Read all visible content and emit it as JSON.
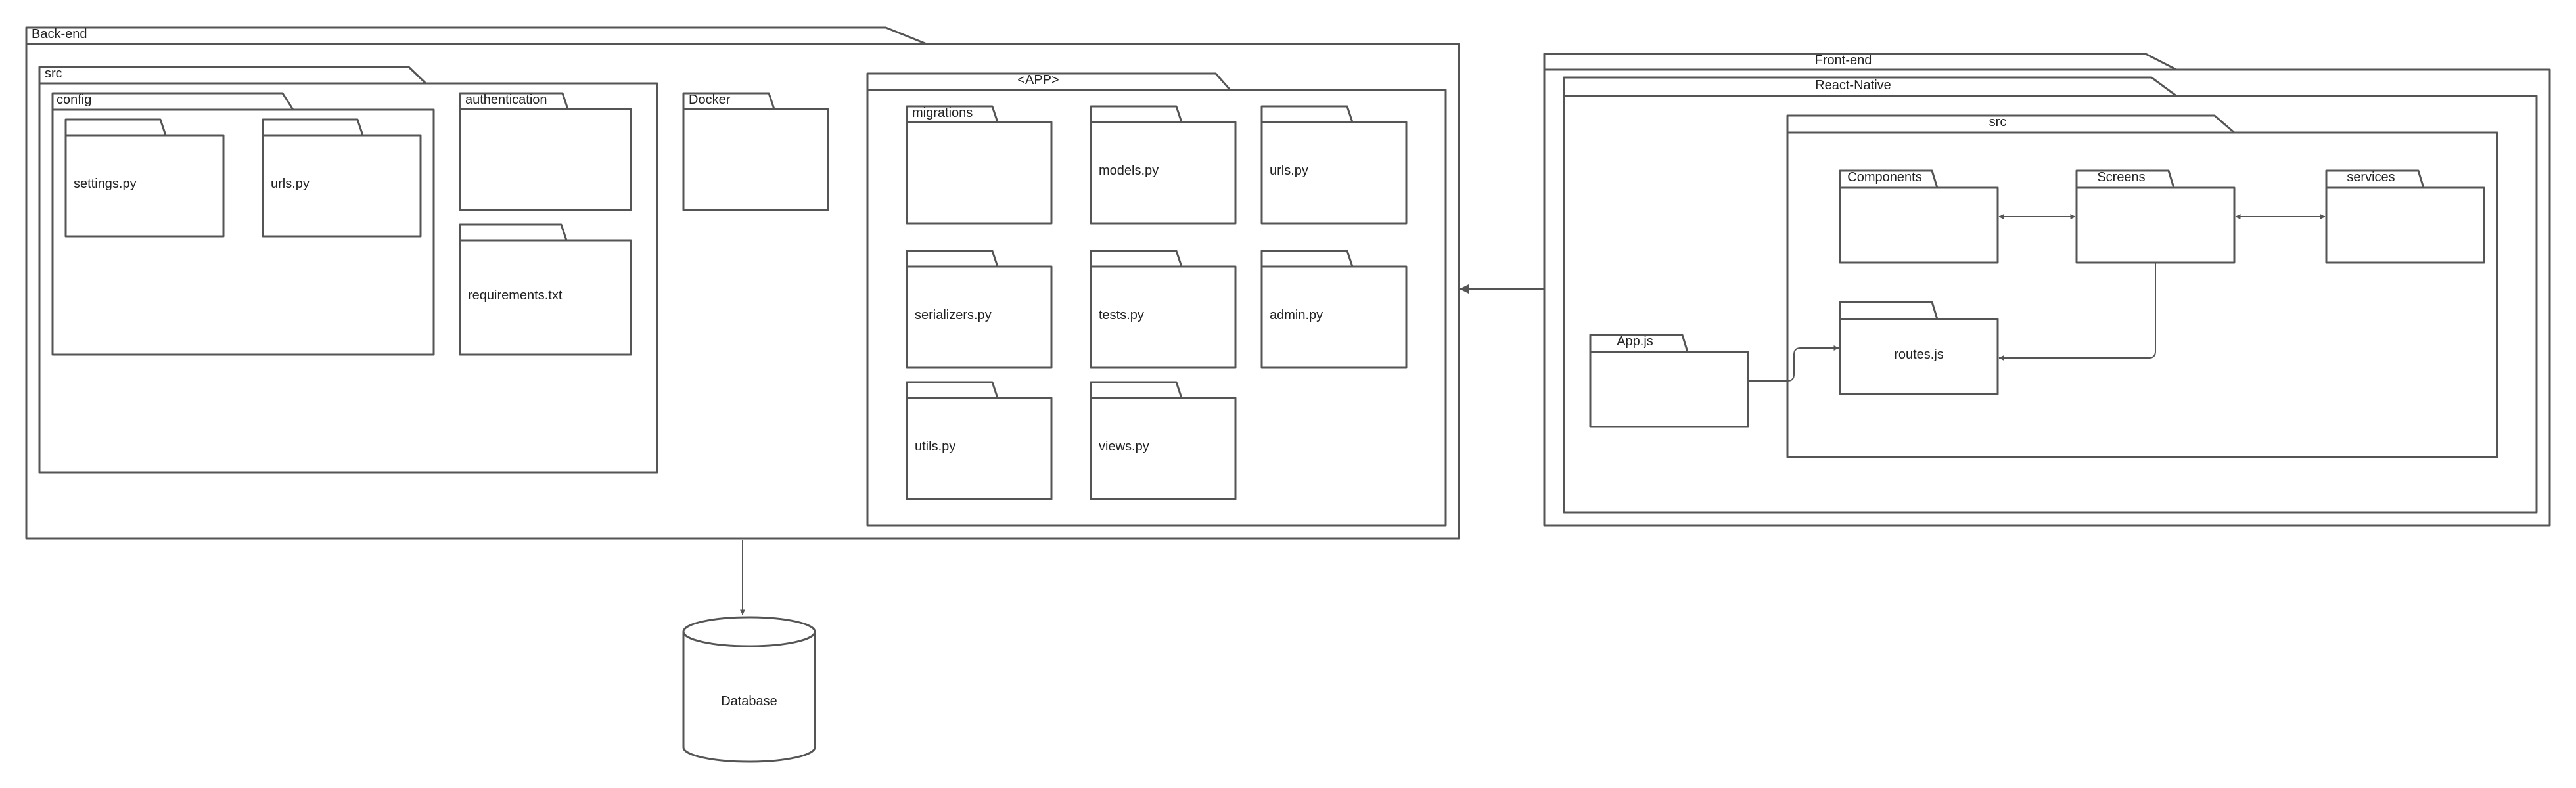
{
  "packages": {
    "backend": "Back-end",
    "backend_src": "src",
    "config": "config",
    "settings_py": "settings.py",
    "config_urls_py": "urls.py",
    "authentication": "authentication",
    "requirements_txt": "requirements.txt",
    "docker": "Docker",
    "app": "<APP>",
    "migrations": "migrations",
    "models_py": "models.py",
    "app_urls_py": "urls.py",
    "serializers_py": "serializers.py",
    "tests_py": "tests.py",
    "admin_py": "admin.py",
    "utils_py": "utils.py",
    "views_py": "views.py",
    "frontend": "Front-end",
    "react_native": "React-Native",
    "frontend_src": "src",
    "components": "Components",
    "screens": "Screens",
    "services": "services",
    "app_js": "App.js",
    "routes_js": "routes.js"
  },
  "database": {
    "label": "Database"
  },
  "connections": [
    "Front-end → Back-end",
    "Back-end → Database",
    "Components ↔ Screens",
    "Screens ↔ services",
    "App.js → routes.js",
    "Screens → routes.js"
  ]
}
